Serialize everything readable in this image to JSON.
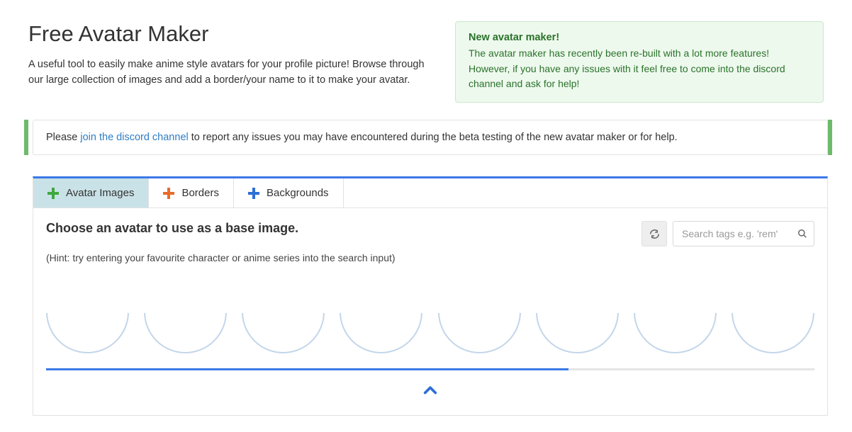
{
  "header": {
    "title": "Free Avatar Maker",
    "description": "A useful tool to easily make anime style avatars for your profile picture! Browse through our large collection of images and add a border/your name to it to make your avatar."
  },
  "alert": {
    "title": "New avatar maker!",
    "body": "The avatar maker has recently been re-built with a lot more features! However, if you have any issues with it feel free to come into the discord channel and ask for help!"
  },
  "discord_notice": {
    "prefix": "Please ",
    "link_text": "join the discord channel",
    "suffix": " to report any issues you may have encountered during the beta testing of the new avatar maker or for help."
  },
  "tabs": [
    {
      "label": "Avatar Images",
      "icon_color": "green",
      "active": true
    },
    {
      "label": "Borders",
      "icon_color": "orange",
      "active": false
    },
    {
      "label": "Backgrounds",
      "icon_color": "blue",
      "active": false
    }
  ],
  "section": {
    "title": "Choose an avatar to use as a base image.",
    "hint": "(Hint: try entering your favourite character or anime series into the search input)"
  },
  "search": {
    "placeholder": "Search tags e.g. 'rem'"
  },
  "progress_percent": 68,
  "avatar_slots": 8
}
